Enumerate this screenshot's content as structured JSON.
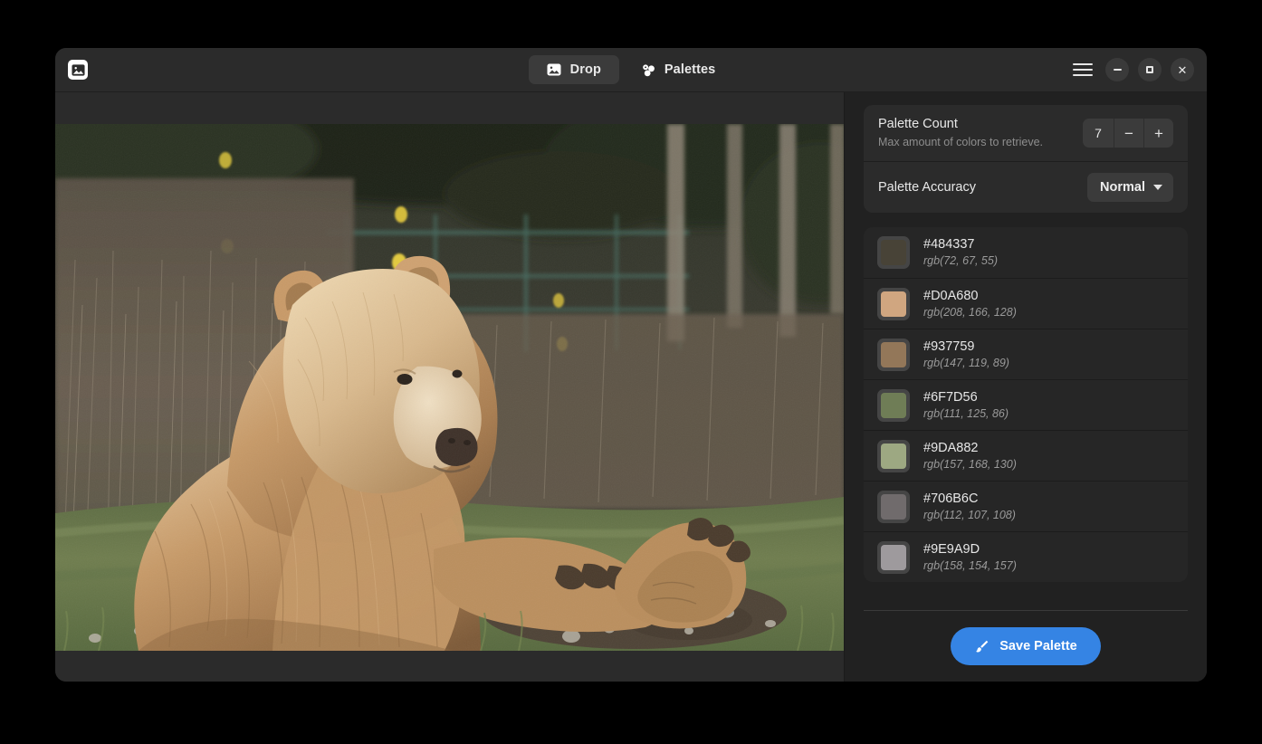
{
  "window": {
    "logo_icon": "image-icon",
    "controls": {
      "menu_icon": "hamburger-menu-icon",
      "minimize_icon": "minimize-icon",
      "maximize_icon": "maximize-icon",
      "close_icon": "close-icon",
      "close_glyph": "✕"
    }
  },
  "tabs": [
    {
      "label": "Drop",
      "icon": "image-icon",
      "active": true
    },
    {
      "label": "Palettes",
      "icon": "palette-circles-icon",
      "active": false
    }
  ],
  "drop_panel": {
    "image_description": "Brown bear sitting in grass in front of dry brush and a green fence"
  },
  "settings": {
    "palette_count": {
      "title": "Palette Count",
      "subtitle": "Max amount of colors to retrieve.",
      "value": "7",
      "decrement_label": "−",
      "increment_label": "+"
    },
    "palette_accuracy": {
      "title": "Palette Accuracy",
      "value": "Normal"
    }
  },
  "palette": [
    {
      "hex": "#484337",
      "rgb": "rgb(72, 67, 55)"
    },
    {
      "hex": "#D0A680",
      "rgb": "rgb(208, 166, 128)"
    },
    {
      "hex": "#937759",
      "rgb": "rgb(147, 119, 89)"
    },
    {
      "hex": "#6F7D56",
      "rgb": "rgb(111, 125, 86)"
    },
    {
      "hex": "#9DA882",
      "rgb": "rgb(157, 168, 130)"
    },
    {
      "hex": "#706B6C",
      "rgb": "rgb(112, 107, 108)"
    },
    {
      "hex": "#9E9A9D",
      "rgb": "rgb(158, 154, 157)"
    }
  ],
  "footer": {
    "save_label": "Save Palette",
    "save_icon": "paintbrush-icon",
    "accent_color": "#3584e4"
  }
}
